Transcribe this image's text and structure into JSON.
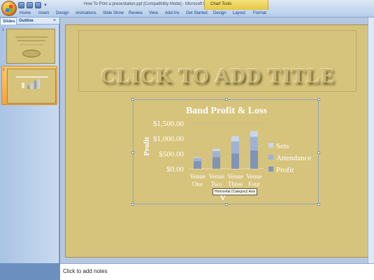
{
  "window": {
    "title": "How To Print a presentation.ppt [Compatibility Mode] - Microsoft PowerPoint",
    "contextual_tab_group": "Chart Tools"
  },
  "ribbon": {
    "tabs": [
      "Home",
      "Insert",
      "Design",
      "Animations",
      "Slide Show",
      "Review",
      "View",
      "Add-Ins",
      "Get Started",
      "Design",
      "Layout",
      "Format"
    ]
  },
  "left_pane": {
    "tabs": [
      "Slides",
      "Outline"
    ],
    "close_glyph": "×",
    "slides": [
      {
        "number": "1"
      },
      {
        "number": "2"
      }
    ]
  },
  "slide": {
    "title_placeholder": "CLICK TO ADD TITLE"
  },
  "tooltip": "Horizontal (Category) Axis",
  "notes_placeholder": "Click to add notes",
  "colors": {
    "slide_background": "#d6c37c",
    "chart_text": "#ffffff",
    "series_profit": "#7f94b8",
    "series_attendance": "#9fb2d6",
    "series_sets": "#c9d5ec",
    "selected_thumbnail": "#f4a43c"
  },
  "icons": [
    "office-button-icon",
    "save-icon",
    "undo-icon",
    "redo-icon",
    "customize-quick-access-icon"
  ],
  "chart_data": {
    "type": "bar",
    "stacked": true,
    "title": "Band Profit & Loss",
    "ylabel": "Profit",
    "xlabel_visible_fragment": "V",
    "categories": [
      [
        "Venue",
        "One"
      ],
      [
        "Venue",
        "Two"
      ],
      [
        "Venue",
        "Three"
      ],
      [
        "Venue",
        "Four"
      ]
    ],
    "y_ticks": [
      "$1,500.00",
      "$1,000.00",
      "$500.00",
      "$0.00"
    ],
    "y_tick_values": [
      1500,
      1000,
      500,
      0
    ],
    "ylim": [
      0,
      1500
    ],
    "grid": true,
    "legend_position": "right",
    "series": [
      {
        "name": "Profit",
        "values": [
          250,
          380,
          500,
          600
        ]
      },
      {
        "name": "Attendance",
        "values": [
          100,
          200,
          400,
          450
        ]
      },
      {
        "name": "Sets",
        "values": [
          20,
          80,
          170,
          190
        ]
      }
    ],
    "legend_order": [
      "Sets",
      "Attendance",
      "Profit"
    ]
  }
}
